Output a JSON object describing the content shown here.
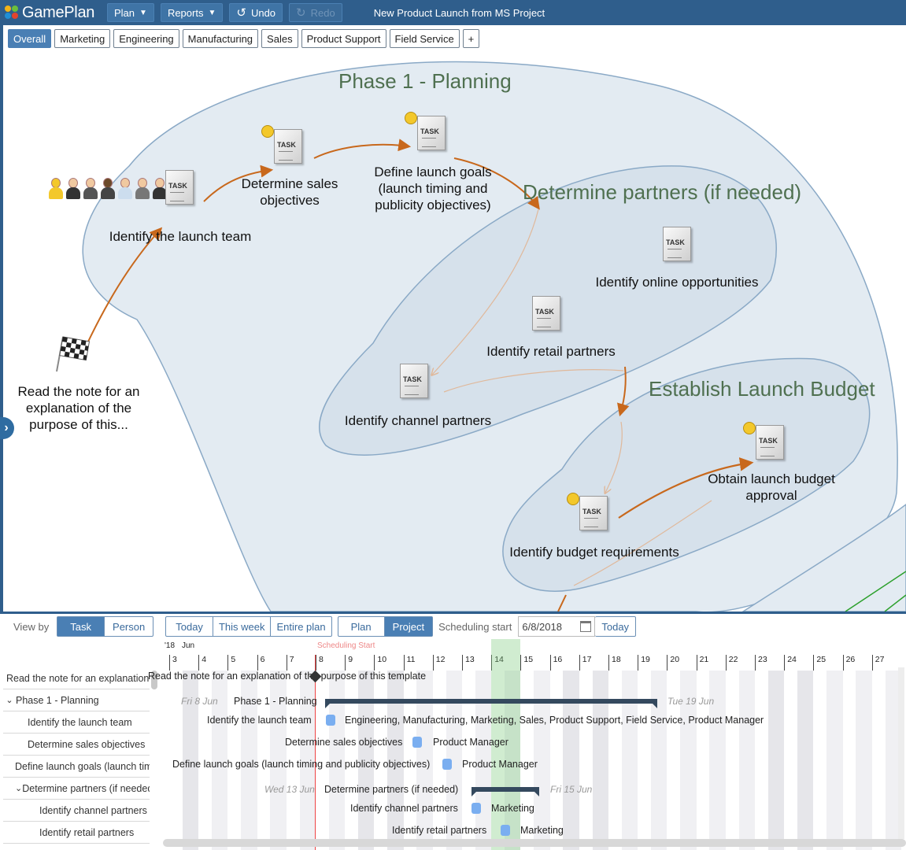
{
  "app": {
    "name": "GamePlan",
    "menu_plan": "Plan",
    "menu_reports": "Reports",
    "undo": "Undo",
    "redo": "Redo",
    "document_title": "New Product Launch from MS Project",
    "brand_color": "#2f5e8c"
  },
  "tabs": [
    {
      "label": "Overall",
      "active": true
    },
    {
      "label": "Marketing"
    },
    {
      "label": "Engineering"
    },
    {
      "label": "Manufacturing"
    },
    {
      "label": "Sales"
    },
    {
      "label": "Product Support"
    },
    {
      "label": "Field Service"
    },
    {
      "label": "+"
    }
  ],
  "canvas": {
    "groups": {
      "phase1": "Phase 1 - Planning",
      "partners": "Determine partners (if needed)",
      "budget": "Establish Launch Budget"
    },
    "nodes": {
      "start_note": "Read the note for an explanation of the purpose of this...",
      "launch_team": "Identify the launch team",
      "sales_objectives": "Determine sales objectives",
      "launch_goals": "Define launch goals (launch timing and publicity objectives)",
      "online": "Identify online opportunities",
      "retail": "Identify retail partners",
      "channel": "Identify channel partners",
      "budget_req": "Identify budget requirements",
      "budget_approval": "Obtain launch budget approval"
    },
    "colors": {
      "group_fill": "#e3ebf2",
      "group_stroke": "#8aa9c6",
      "arrow": "#c8681c"
    }
  },
  "controls": {
    "view_by_label": "View by",
    "view_task": "Task",
    "view_person": "Person",
    "today": "Today",
    "this_week": "This week",
    "entire_plan": "Entire plan",
    "plan": "Plan",
    "project": "Project",
    "scheduling_start_label": "Scheduling start",
    "scheduling_start_value": "6/8/2018",
    "today2": "Today"
  },
  "gantt": {
    "year_label": "'18",
    "month_label": "Jun",
    "scheduling_start_marker": "Scheduling Start",
    "days": [
      "3",
      "4",
      "5",
      "6",
      "7",
      "8",
      "9",
      "10",
      "11",
      "12",
      "13",
      "14",
      "15",
      "16",
      "17",
      "18",
      "19",
      "20",
      "21",
      "22",
      "23",
      "24",
      "25",
      "26",
      "27"
    ],
    "tree": [
      {
        "label": "Read the note for an explanation of the purpose of this template",
        "indent": 0,
        "chevron": ""
      },
      {
        "label": "Phase 1 - Planning",
        "indent": 0,
        "chevron": "v"
      },
      {
        "label": "Identify the launch team",
        "indent": 1,
        "chevron": ""
      },
      {
        "label": "Determine sales objectives",
        "indent": 1,
        "chevron": ""
      },
      {
        "label": "Define launch goals (launch timing and publicity objectives)",
        "indent": 1,
        "chevron": ""
      },
      {
        "label": "Determine partners (if needed)",
        "indent": 1,
        "chevron": "v"
      },
      {
        "label": "Identify channel partners",
        "indent": 2,
        "chevron": ""
      },
      {
        "label": "Identify retail partners",
        "indent": 2,
        "chevron": ""
      },
      {
        "label": "Identify online opportunities",
        "indent": 2,
        "chevron": ""
      }
    ],
    "rows": {
      "phase1_start": "Fri 8 Jun",
      "phase1_label": "Phase 1 - Planning",
      "phase1_end": "Tue 19 Jun",
      "team_label": "Identify the launch team",
      "team_assignees": "Engineering, Manufacturing, Marketing, Sales, Product Support, Field Service, Product Manager",
      "sales_label": "Determine sales objectives",
      "sales_assignees": "Product Manager",
      "goals_label": "Define launch goals (launch timing and publicity objectives)",
      "goals_assignees": "Product Manager",
      "partners_start": "Wed 13 Jun",
      "partners_label": "Determine partners (if needed)",
      "partners_end": "Fri 15 Jun",
      "channel_label": "Identify channel partners",
      "channel_assignees": "Marketing",
      "retail_label": "Identify retail partners",
      "retail_assignees": "Marketing"
    }
  }
}
